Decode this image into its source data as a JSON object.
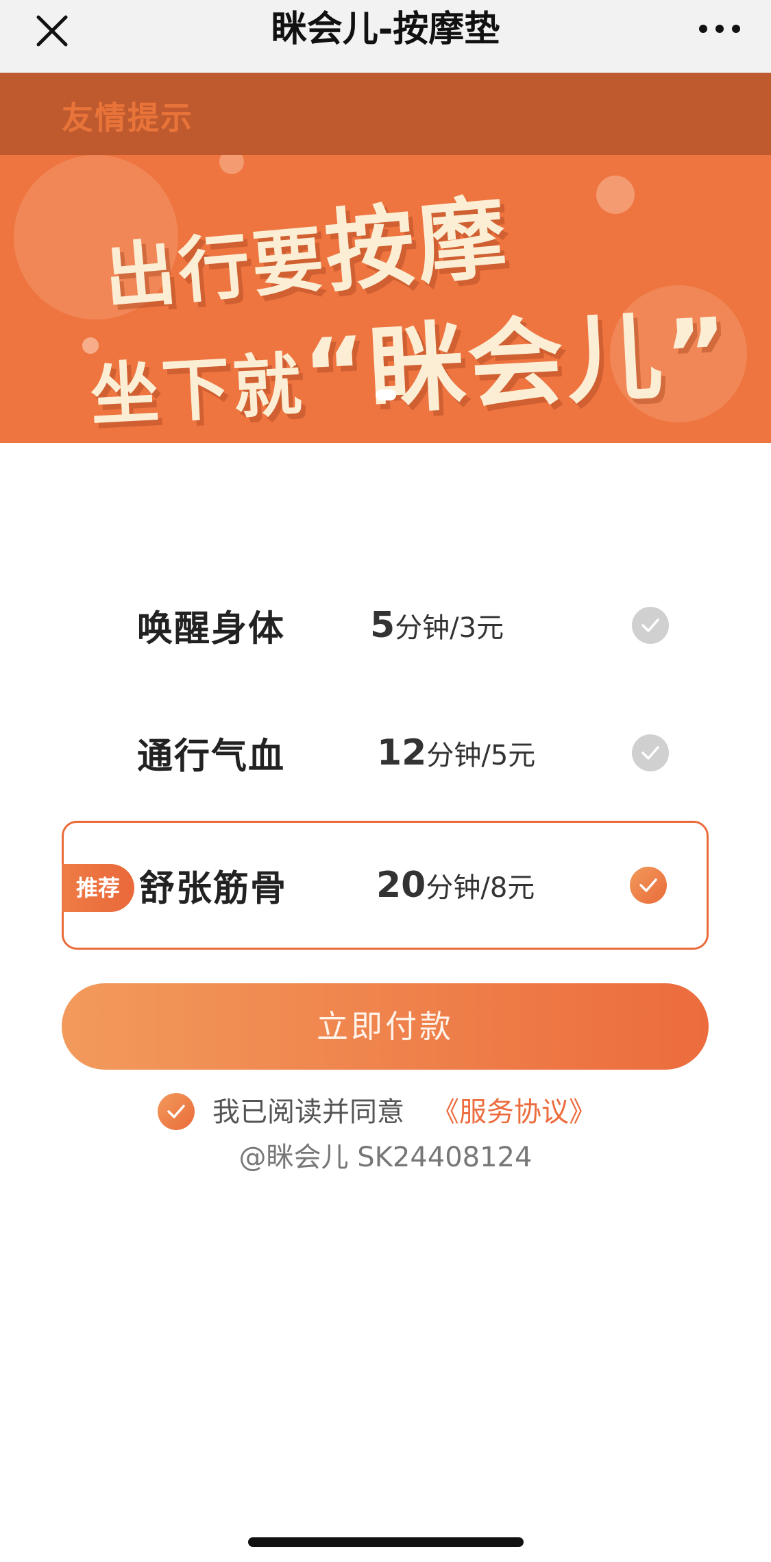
{
  "navbar": {
    "title": "眯会儿-按摩垫",
    "close_icon": "close-icon",
    "more_icon": "more-dots-icon"
  },
  "banner": {
    "notice": "友情提示",
    "line1_a": "出行要",
    "line1_b": "按摩",
    "line2_a": "坐下就",
    "line2_b": "“眯会儿”",
    "indicator_pages": 1,
    "indicator_active": 1
  },
  "options": [
    {
      "name": "唤醒身体",
      "minutes": "5",
      "unit": "分钟/3元",
      "selected": false,
      "badge": ""
    },
    {
      "name": "通行气血",
      "minutes": "12",
      "unit": "分钟/5元",
      "selected": false,
      "badge": ""
    },
    {
      "name": "舒张筋骨",
      "minutes": "20",
      "unit": "分钟/8元",
      "selected": true,
      "badge": "推荐"
    }
  ],
  "pay_button": {
    "label": "立即付款"
  },
  "agreement": {
    "text": "我已阅读并同意",
    "link": "《服务协议》",
    "checked": true
  },
  "device_id": "@眯会儿 SK24408124",
  "colors": {
    "accent": "#ec6c3d",
    "accent_light": "#f29a5c",
    "banner_bg": "#ee7440",
    "banner_strip": "#bf5a2f",
    "check_off": "#d0d0d0"
  }
}
